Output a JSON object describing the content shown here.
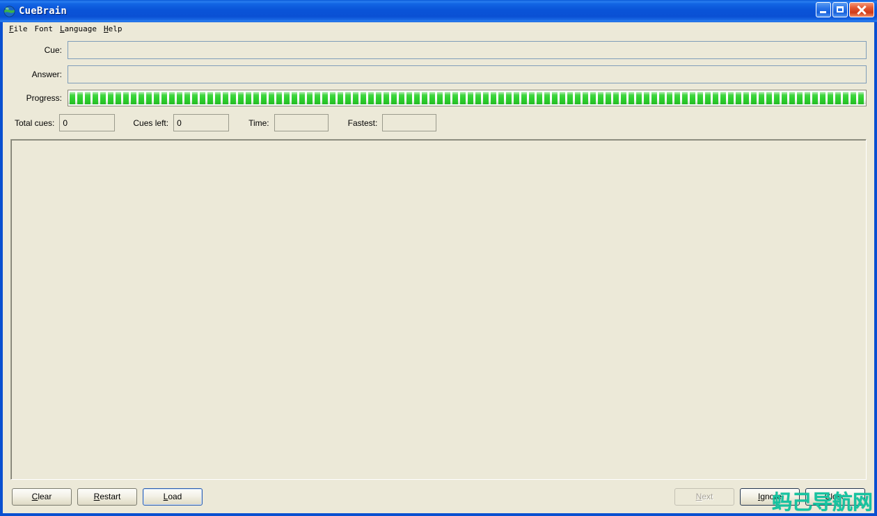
{
  "window": {
    "title": "CueBrain",
    "icon": "globe-icon",
    "controls": {
      "minimize": "Minimize",
      "maximize": "Maximize",
      "close": "Close"
    },
    "accent_titlebar": "#0a50d0",
    "accent_client": "#ece9d8"
  },
  "menu": {
    "items": [
      {
        "label": "File",
        "mnemonic": "F"
      },
      {
        "label": "Font",
        "mnemonic": ""
      },
      {
        "label": "Language",
        "mnemonic": "L"
      },
      {
        "label": "Help",
        "mnemonic": "H"
      }
    ]
  },
  "form": {
    "cue": {
      "label": "Cue:",
      "value": "",
      "placeholder": ""
    },
    "answer": {
      "label": "Answer:",
      "value": "",
      "placeholder": ""
    },
    "progress": {
      "label": "Progress:",
      "value": 100,
      "max": 100,
      "color": "#2fd12f"
    }
  },
  "stats": {
    "total_cues": {
      "label": "Total cues:",
      "value": "0"
    },
    "cues_left": {
      "label": "Cues left:",
      "value": "0"
    },
    "time": {
      "label": "Time:",
      "value": ""
    },
    "fastest": {
      "label": "Fastest:",
      "value": ""
    }
  },
  "content_panel": {
    "text": ""
  },
  "buttons": {
    "left": [
      {
        "name": "clear",
        "label": "Clear",
        "mnemonic": "C",
        "state": "normal"
      },
      {
        "name": "restart",
        "label": "Restart",
        "mnemonic": "R",
        "state": "normal"
      },
      {
        "name": "load",
        "label": "Load",
        "mnemonic": "L",
        "state": "focused"
      }
    ],
    "right": [
      {
        "name": "next",
        "label": "Next",
        "mnemonic": "N",
        "state": "disabled"
      },
      {
        "name": "ignore",
        "label": "Ignore",
        "mnemonic": "I",
        "state": "default"
      },
      {
        "name": "close",
        "label": "Close",
        "mnemonic": "C",
        "state": "default"
      }
    ]
  },
  "watermark": {
    "text": "蚂己导航网",
    "color": "#17c3a0"
  }
}
